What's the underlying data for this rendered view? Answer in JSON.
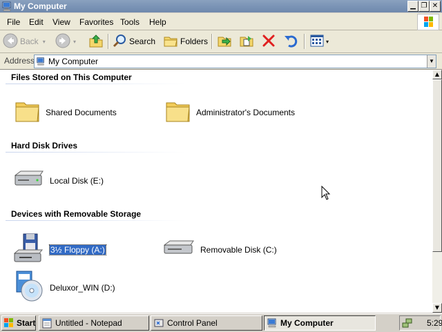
{
  "window": {
    "title": "My Computer",
    "app_icon": "computer-icon",
    "controls": [
      "minimize",
      "restore",
      "close"
    ]
  },
  "menu": {
    "items": [
      "File",
      "Edit",
      "View",
      "Favorites",
      "Tools",
      "Help"
    ]
  },
  "toolbar": {
    "back_label": "Back",
    "search_label": "Search",
    "folders_label": "Folders"
  },
  "address": {
    "label": "Address",
    "value": "My Computer"
  },
  "groups": [
    {
      "title": "Files Stored on This Computer",
      "items": [
        {
          "label": "Shared Documents",
          "icon": "folder-icon"
        },
        {
          "label": "Administrator's Documents",
          "icon": "folder-icon"
        }
      ]
    },
    {
      "title": "Hard Disk Drives",
      "items": [
        {
          "label": "Local Disk (E:)",
          "icon": "hard-disk-icon"
        }
      ]
    },
    {
      "title": "Devices with Removable Storage",
      "items": [
        {
          "label": "3½ Floppy (A:)",
          "icon": "floppy-drive-icon",
          "selected": true
        },
        {
          "label": "Removable Disk (C:)",
          "icon": "removable-disk-icon"
        },
        {
          "label": "Deluxor_WIN (D:)",
          "icon": "cd-drive-icon"
        }
      ]
    }
  ],
  "taskbar": {
    "start_label": "Start",
    "tasks": [
      {
        "label": "Untitled - Notepad",
        "icon": "notepad-icon"
      },
      {
        "label": "Control Panel",
        "icon": "control-panel-icon"
      },
      {
        "label": "My Computer",
        "icon": "computer-icon",
        "active": true
      }
    ],
    "clock": "5:29"
  }
}
